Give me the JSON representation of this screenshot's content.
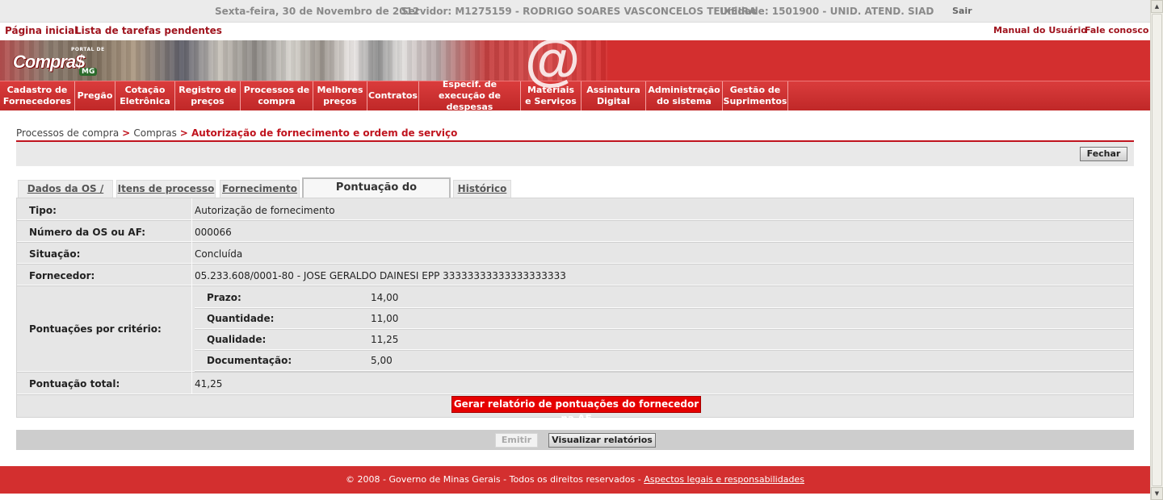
{
  "topbar": {
    "date": "Sexta-feira, 30 de Novembro de 2012",
    "server": "Servidor: M1275159 - RODRIGO SOARES VASCONCELOS TEIXEIRA",
    "unit": "Unidade: 1501900 - UNID. ATEND. SIAD",
    "logout": "Sair"
  },
  "links": {
    "home": "Página inicial",
    "tasks": "Lista de tarefas pendentes",
    "manual": "Manual do Usuário",
    "contact": "Fale conosco"
  },
  "logo": {
    "small": "PORTAL DE",
    "main": "Compra$",
    "state": "MG"
  },
  "nav": [
    {
      "label": "Cadastro de Fornecedores"
    },
    {
      "label": "Pregão"
    },
    {
      "label": "Cotação Eletrônica"
    },
    {
      "label": "Registro de preços"
    },
    {
      "label": "Processos de compra"
    },
    {
      "label": "Melhores preços"
    },
    {
      "label": "Contratos"
    },
    {
      "label": "Especif. de execução de despesas"
    },
    {
      "label": "Materiais e Serviços"
    },
    {
      "label": "Assinatura Digital"
    },
    {
      "label": "Administração do sistema"
    },
    {
      "label": "Gestão de Suprimentos"
    }
  ],
  "breadcrumb": {
    "part1": "Processos de compra",
    "sep": ">",
    "part2": "Compras",
    "current": "Autorização de fornecimento e ordem de serviço"
  },
  "buttons": {
    "close": "Fechar",
    "report": "Gerar relatório de pontuações do fornecedor na AF",
    "emit": "Emitir",
    "view_reports": "Visualizar relatórios"
  },
  "tabs": [
    {
      "label": "Dados da OS / AF",
      "active": false
    },
    {
      "label": "Itens de processo",
      "active": false
    },
    {
      "label": "Fornecimento",
      "active": false
    },
    {
      "label": "Pontuação do fornecedor",
      "active": true
    },
    {
      "label": "Histórico",
      "active": false
    }
  ],
  "form": {
    "tipo_label": "Tipo:",
    "tipo_value": "Autorização de fornecimento",
    "numero_label": "Número da OS ou AF:",
    "numero_value": "000066",
    "situacao_label": "Situação:",
    "situacao_value": "Concluída",
    "fornecedor_label": "Fornecedor:",
    "fornecedor_value": "05.233.608/0001-80 - JOSE GERALDO DAINESI EPP 33333333333333333333",
    "criterios_label": "Pontuações por critério:",
    "criterios": [
      {
        "label": "Prazo:",
        "value": "14,00"
      },
      {
        "label": "Quantidade:",
        "value": "11,00"
      },
      {
        "label": "Qualidade:",
        "value": "11,25"
      },
      {
        "label": "Documentação:",
        "value": "5,00"
      }
    ],
    "total_label": "Pontuação total:",
    "total_value": "41,25"
  },
  "footer": {
    "text": "© 2008 - Governo de Minas Gerais - Todos os direitos reservados - ",
    "legal": "Aspectos legais e responsabilidades"
  }
}
